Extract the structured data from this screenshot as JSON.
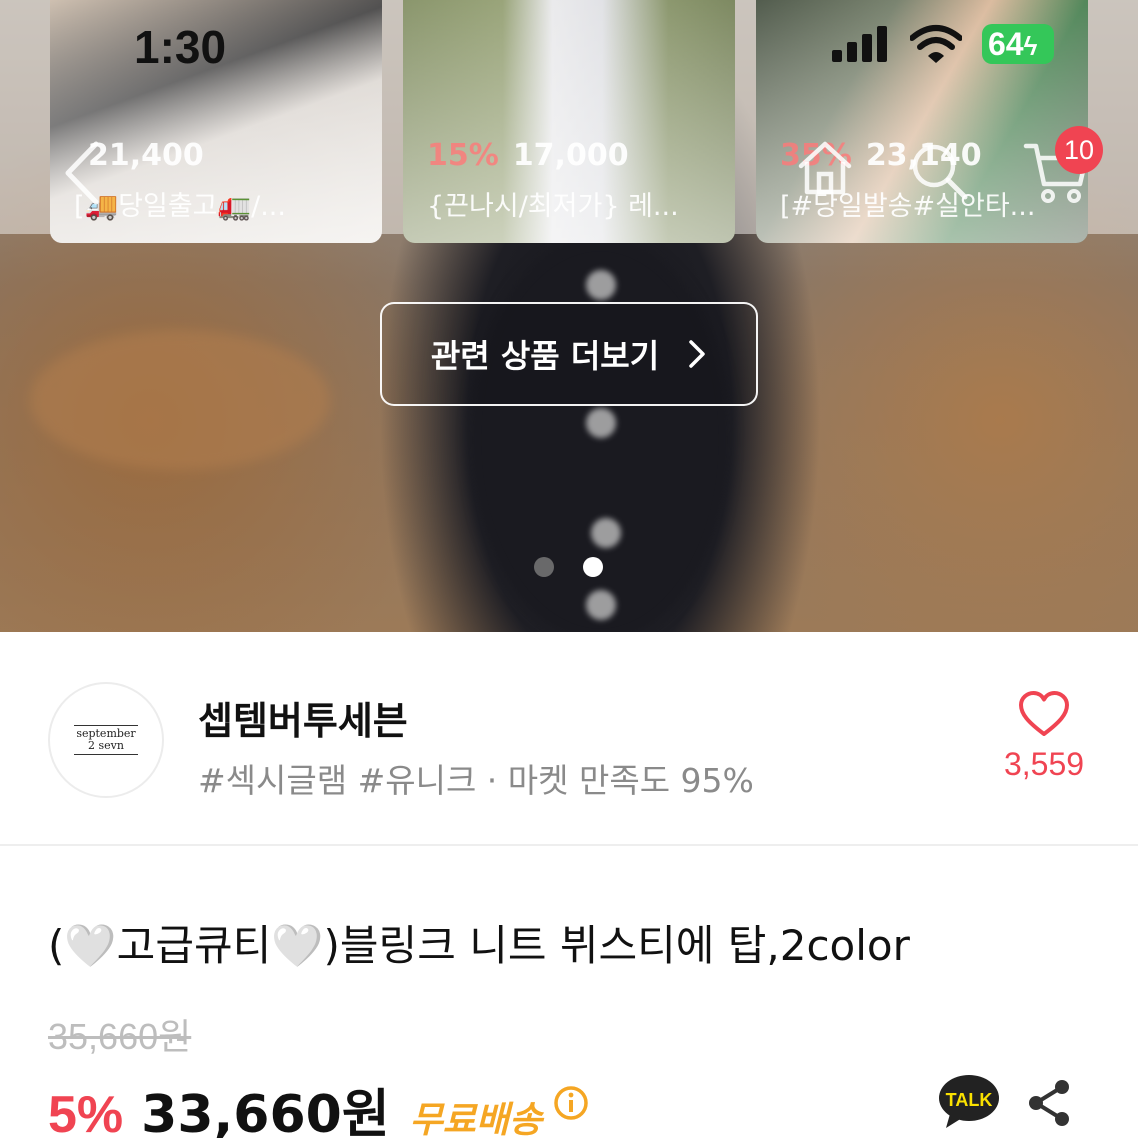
{
  "status_bar": {
    "time": "1:30",
    "battery": "64"
  },
  "related_products": [
    {
      "discount": "",
      "price": "21,400",
      "name": "[🚚당일출고🚛/..."
    },
    {
      "discount": "15%",
      "price": "17,000",
      "name": "{끈나시/최저가} 레..."
    },
    {
      "discount": "35%",
      "price": "23,140",
      "name": "[#당일발송#실안타..."
    }
  ],
  "nav": {
    "cart_count": "10"
  },
  "related_button_label": "관련 상품 더보기",
  "carousel": {
    "total": 2,
    "active": 2
  },
  "seller": {
    "name": "셉템버투세븐",
    "tags": "#섹시글램 #유니크 · 마켓 만족도 95%",
    "logo_text_1": "september",
    "logo_text_2": "2 sevn",
    "likes": "3,559"
  },
  "product": {
    "title": "(🤍고급큐티🤍)블링크 니트 뷔스티에 탑,2color",
    "original_price": "35,660원",
    "discount": "5%",
    "sale_price": "33,660원",
    "shipping": "무료배송"
  },
  "talk_label": "TALK",
  "colors": {
    "accent_red": "#f04452",
    "shipping_orange": "#f5a623",
    "talk_yellow": "#fae100"
  }
}
